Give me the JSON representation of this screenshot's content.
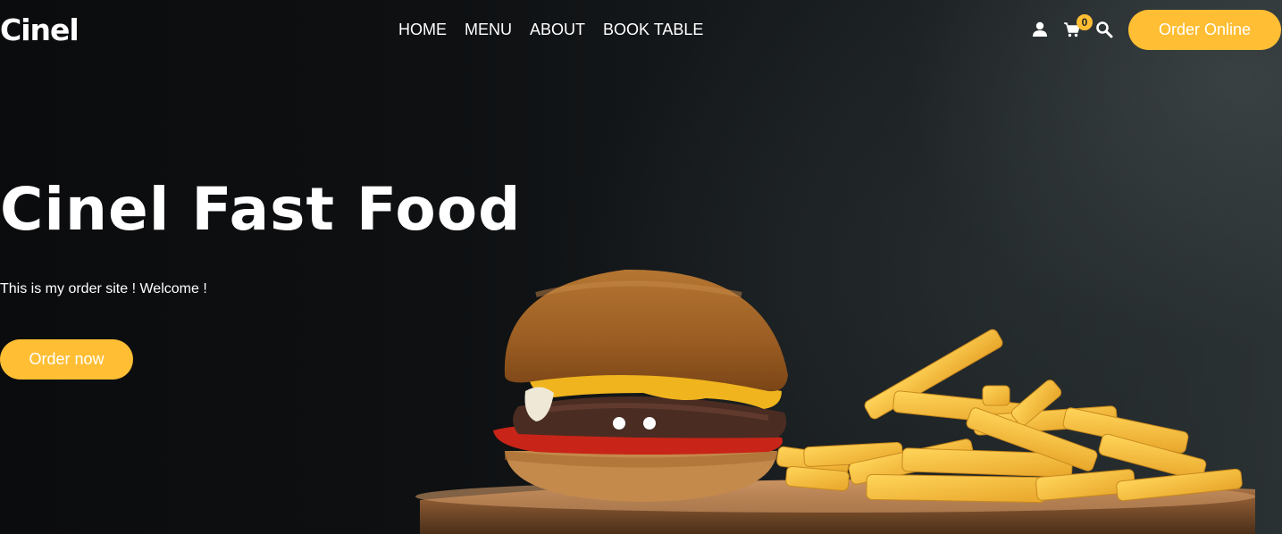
{
  "brand": {
    "logo_text": "Cinel"
  },
  "nav": {
    "items": [
      {
        "label": "HOME"
      },
      {
        "label": "MENU"
      },
      {
        "label": "ABOUT"
      },
      {
        "label": "BOOK TABLE"
      }
    ]
  },
  "header_actions": {
    "user_icon": "user-icon",
    "cart_icon": "cart-icon",
    "cart_count": "0",
    "search_icon": "search-icon",
    "order_online_label": "Order Online"
  },
  "hero": {
    "title": "Cinel Fast Food",
    "subtitle": "This is my order site ! Welcome !",
    "cta_label": "Order now",
    "image": "burger-and-fries-image",
    "slide_count": 2
  },
  "colors": {
    "accent": "#ffbe33",
    "background": "#0d0f11",
    "text": "#ffffff"
  }
}
